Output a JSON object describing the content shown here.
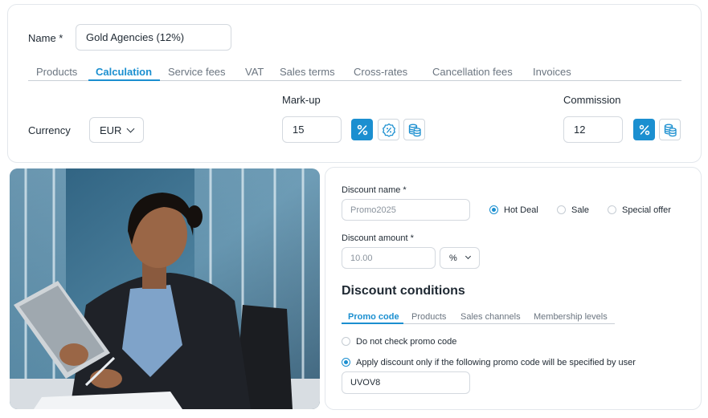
{
  "top": {
    "name_label": "Name *",
    "name_value": "Gold Agencies (12%)",
    "tabs": [
      {
        "label": "Products",
        "active": false
      },
      {
        "label": "Calculation",
        "active": true
      },
      {
        "label": "Service fees",
        "active": false
      },
      {
        "label": "VAT",
        "active": false
      },
      {
        "label": "Sales terms",
        "active": false
      },
      {
        "label": "Cross-rates",
        "active": false
      },
      {
        "label": "Cancellation fees",
        "active": false
      },
      {
        "label": "Invoices",
        "active": false
      }
    ],
    "currency_label": "Currency",
    "currency_value": "EUR",
    "markup_label": "Mark-up",
    "markup_value": "15",
    "commission_label": "Commission",
    "commission_value": "12"
  },
  "icons": {
    "markup": [
      "percent-icon",
      "discount-badge-icon",
      "coins-stack-icon"
    ],
    "commission": [
      "percent-icon",
      "coins-stack-icon"
    ]
  },
  "discount": {
    "name_label": "Discount name *",
    "name_placeholder": "Promo2025",
    "types": [
      {
        "label": "Hot Deal",
        "checked": true
      },
      {
        "label": "Sale",
        "checked": false
      },
      {
        "label": "Special offer",
        "checked": false
      }
    ],
    "amount_label": "Discount amount *",
    "amount_placeholder": "10.00",
    "unit_value": "%",
    "conditions_title": "Discount conditions",
    "condition_tabs": [
      {
        "label": "Promo code",
        "active": true
      },
      {
        "label": "Products",
        "active": false
      },
      {
        "label": "Sales channels",
        "active": false
      },
      {
        "label": "Membership levels",
        "active": false
      }
    ],
    "options": [
      {
        "label": "Do not check promo code",
        "checked": false
      },
      {
        "label": "Apply discount only if the following promo code will be specified by user",
        "checked": true
      }
    ],
    "promo_code_value": "UVOV8"
  },
  "colors": {
    "accent": "#1b8fd0",
    "border": "#d4d9df"
  }
}
